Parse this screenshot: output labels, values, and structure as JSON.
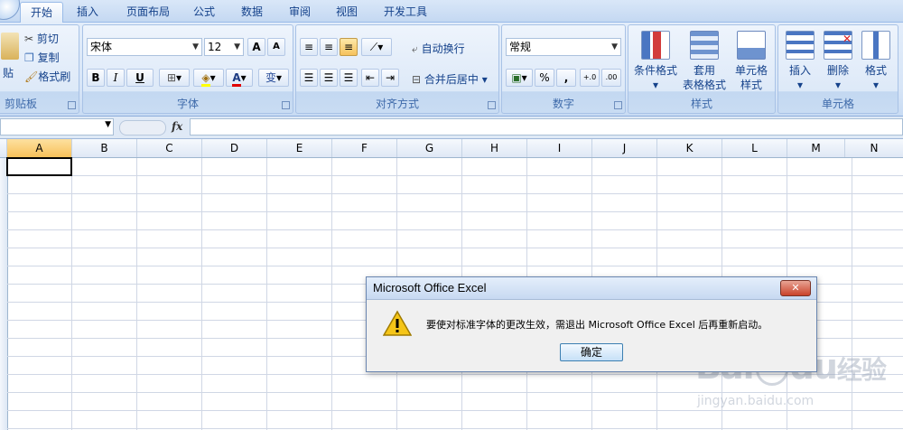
{
  "tabs": [
    "开始",
    "插入",
    "页面布局",
    "公式",
    "数据",
    "审阅",
    "视图",
    "开发工具"
  ],
  "clipboard": {
    "paste_label": "贴",
    "cut_label": "剪切",
    "copy_label": "复制",
    "format_painter_label": "格式刷",
    "group_label": "剪贴板"
  },
  "font": {
    "name": "宋体",
    "size": "12",
    "bold": "B",
    "italic": "I",
    "underline": "U",
    "font_color": "A",
    "phonetic": "变",
    "group_label": "字体"
  },
  "alignment": {
    "wrap_label": "自动换行",
    "merge_label": "合并后居中",
    "group_label": "对齐方式"
  },
  "number": {
    "format": "常规",
    "percent": "%",
    "comma": ",",
    "group_label": "数字"
  },
  "styles": {
    "cond_format": "条件格式",
    "table_format_1": "套用",
    "table_format_2": "表格格式",
    "cell_styles_1": "单元格",
    "cell_styles_2": "样式",
    "group_label": "样式"
  },
  "cells": {
    "insert": "插入",
    "delete": "删除",
    "format": "格式",
    "group_label": "单元格"
  },
  "formula_bar": {
    "fx": "fx",
    "name_box": ""
  },
  "columns": [
    "A",
    "B",
    "C",
    "D",
    "E",
    "F",
    "G",
    "H",
    "I",
    "J",
    "K",
    "L",
    "M",
    "N"
  ],
  "dialog": {
    "title": "Microsoft Office Excel",
    "close": "✕",
    "message": "要使对标准字体的更改生效，需退出 Microsoft Office Excel 后再重新启动。",
    "ok": "确定",
    "icon": "warning-icon"
  },
  "watermark": {
    "brand_a": "Bai",
    "brand_b": "du",
    "brand_c": "经验",
    "url": "jingyan.baidu.com"
  }
}
